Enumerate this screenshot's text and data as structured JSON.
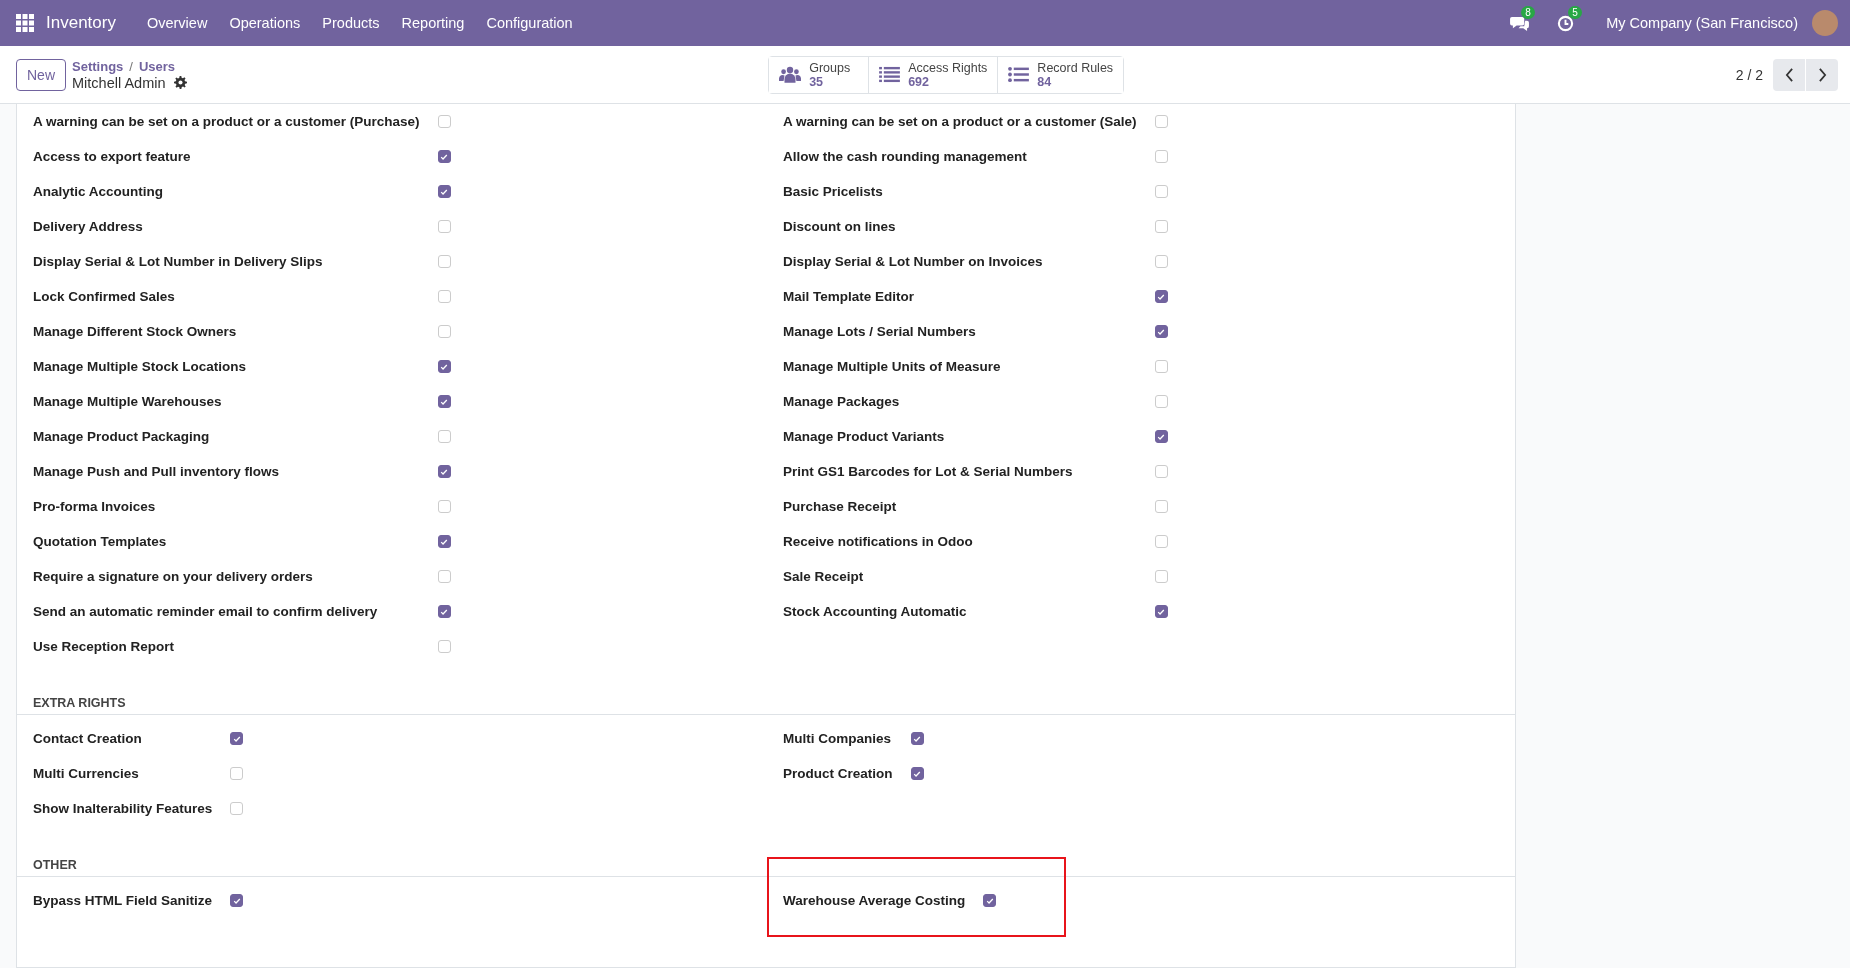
{
  "navbar": {
    "app_name": "Inventory",
    "menu": [
      "Overview",
      "Operations",
      "Products",
      "Reporting",
      "Configuration"
    ],
    "messages_count": "8",
    "activities_count": "5",
    "company": "My Company (San Francisco)"
  },
  "control_panel": {
    "new_button": "New",
    "breadcrumbs": [
      "Settings",
      "Users"
    ],
    "breadcrumb_separator": "/",
    "record_title": "Mitchell Admin",
    "stats": [
      {
        "kind": "groups",
        "label": "Groups",
        "value": "35"
      },
      {
        "kind": "list",
        "label": "Access Rights",
        "value": "692"
      },
      {
        "kind": "rules",
        "label": "Record Rules",
        "value": "84"
      }
    ],
    "pager": "2 / 2"
  },
  "sections": [
    {
      "left": [
        {
          "label": "A warning can be set on a product or a customer (Purchase)",
          "checked": false,
          "highlighted": false
        },
        {
          "label": "Access to export feature",
          "checked": true,
          "highlighted": false
        },
        {
          "label": "Analytic Accounting",
          "checked": true,
          "highlighted": false
        },
        {
          "label": "Delivery Address",
          "checked": false,
          "highlighted": false
        },
        {
          "label": "Display Serial & Lot Number in Delivery Slips",
          "checked": false,
          "highlighted": false
        },
        {
          "label": "Lock Confirmed Sales",
          "checked": false,
          "highlighted": false
        },
        {
          "label": "Manage Different Stock Owners",
          "checked": false,
          "highlighted": false
        },
        {
          "label": "Manage Multiple Stock Locations",
          "checked": true,
          "highlighted": false
        },
        {
          "label": "Manage Multiple Warehouses",
          "checked": true,
          "highlighted": false
        },
        {
          "label": "Manage Product Packaging",
          "checked": false,
          "highlighted": false
        },
        {
          "label": "Manage Push and Pull inventory flows",
          "checked": true,
          "highlighted": false
        },
        {
          "label": "Pro-forma Invoices",
          "checked": false,
          "highlighted": false
        },
        {
          "label": "Quotation Templates",
          "checked": true,
          "highlighted": false
        },
        {
          "label": "Require a signature on your delivery orders",
          "checked": false,
          "highlighted": false
        },
        {
          "label": "Send an automatic reminder email to confirm delivery",
          "checked": true,
          "highlighted": false
        },
        {
          "label": "Use Reception Report",
          "checked": false,
          "highlighted": false
        }
      ],
      "right": [
        {
          "label": "A warning can be set on a product or a customer (Sale)",
          "checked": false,
          "highlighted": false
        },
        {
          "label": "Allow the cash rounding management",
          "checked": false,
          "highlighted": false
        },
        {
          "label": "Basic Pricelists",
          "checked": false,
          "highlighted": false
        },
        {
          "label": "Discount on lines",
          "checked": false,
          "highlighted": false
        },
        {
          "label": "Display Serial & Lot Number on Invoices",
          "checked": false,
          "highlighted": false
        },
        {
          "label": "Mail Template Editor",
          "checked": true,
          "highlighted": false
        },
        {
          "label": "Manage Lots / Serial Numbers",
          "checked": true,
          "highlighted": false
        },
        {
          "label": "Manage Multiple Units of Measure",
          "checked": false,
          "highlighted": false
        },
        {
          "label": "Manage Packages",
          "checked": false,
          "highlighted": false
        },
        {
          "label": "Manage Product Variants",
          "checked": true,
          "highlighted": false
        },
        {
          "label": "Print GS1 Barcodes for Lot & Serial Numbers",
          "checked": false,
          "highlighted": false
        },
        {
          "label": "Purchase Receipt",
          "checked": false,
          "highlighted": false
        },
        {
          "label": "Receive notifications in Odoo",
          "checked": false,
          "highlighted": false
        },
        {
          "label": "Sale Receipt",
          "checked": false,
          "highlighted": false
        },
        {
          "label": "Stock Accounting Automatic",
          "checked": true,
          "highlighted": false
        }
      ]
    },
    {
      "title": "EXTRA RIGHTS",
      "left": [
        {
          "label": "Contact Creation",
          "checked": true,
          "highlighted": false
        },
        {
          "label": "Multi Currencies",
          "checked": false,
          "highlighted": false
        },
        {
          "label": "Show Inalterability Features",
          "checked": false,
          "highlighted": false
        }
      ],
      "right": [
        {
          "label": "Multi Companies",
          "checked": true,
          "highlighted": false
        },
        {
          "label": "Product Creation",
          "checked": true,
          "highlighted": false
        }
      ]
    },
    {
      "title": "OTHER",
      "left": [
        {
          "label": "Bypass HTML Field Sanitize",
          "checked": true,
          "highlighted": false
        }
      ],
      "right": [
        {
          "label": "Warehouse Average Costing",
          "checked": true,
          "highlighted": true
        }
      ]
    }
  ]
}
